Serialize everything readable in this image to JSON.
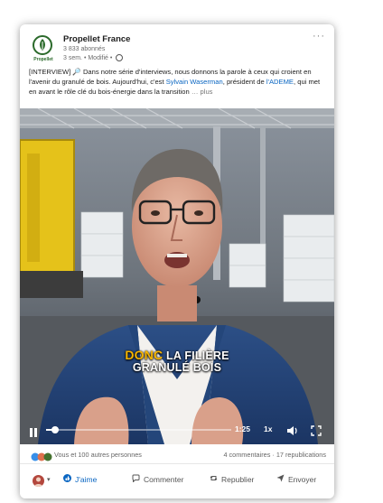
{
  "post": {
    "company_name": "Propellet France",
    "logo_text": "Propellet",
    "followers": "3 833 abonnés",
    "meta_time": "3 sem. • Modifié •",
    "more_icon": "ellipsis-icon",
    "text_part1": "[INTERVIEW] 🔎 Dans notre série d'interviews, nous donnons la parole à ceux qui croient en l'avenir du granulé de bois. Aujourd'hui, c'est ",
    "mention_1": "Sylvain Waserman",
    "text_part2": ", président de ",
    "mention_2": "l'ADEME",
    "text_part3": ", qui met en avant le rôle clé du bois-énergie dans la transition",
    "see_more": " … plus"
  },
  "video": {
    "caption_highlight": "DONC",
    "caption_line1_rest": " LA FILIÈRE",
    "caption_line2": "GRANULÉ BOIS",
    "time_remaining": "1:25",
    "speed": "1x",
    "progress_fraction": 0.05,
    "icons": [
      "pause-icon",
      "volume-icon",
      "fullscreen-icon"
    ]
  },
  "social": {
    "reactions_text": "Vous et 100 autres personnes",
    "counts_text": "4 commentaires · 17 republications"
  },
  "actions": {
    "like": "J'aime",
    "comment": "Commenter",
    "repost": "Republier",
    "send": "Envoyer"
  },
  "colors": {
    "accent": "#0a66c2",
    "caption_highlight": "#f7b500"
  }
}
